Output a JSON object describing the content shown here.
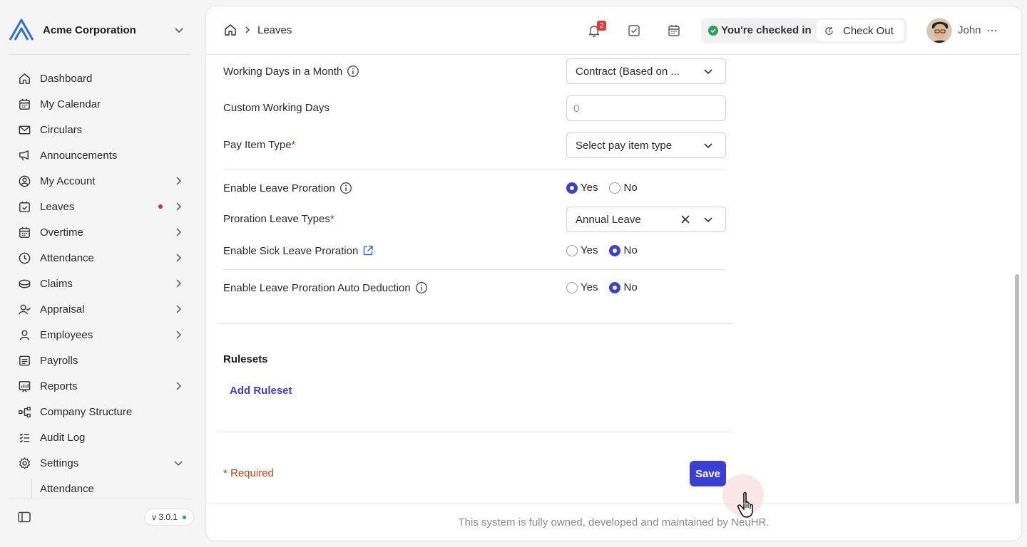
{
  "org": {
    "name": "Acme Corporation"
  },
  "sidebar": {
    "items": [
      {
        "label": "Dashboard",
        "icon": "home-icon"
      },
      {
        "label": "My Calendar",
        "icon": "calendar-icon"
      },
      {
        "label": "Circulars",
        "icon": "mail-icon"
      },
      {
        "label": "Announcements",
        "icon": "megaphone-icon"
      },
      {
        "label": "My Account",
        "icon": "user-circle-icon"
      },
      {
        "label": "Leaves",
        "icon": "calendar-check-icon"
      },
      {
        "label": "Overtime",
        "icon": "calendar-clock-icon"
      },
      {
        "label": "Attendance",
        "icon": "clock-icon"
      },
      {
        "label": "Claims",
        "icon": "coins-icon"
      },
      {
        "label": "Appraisal",
        "icon": "user-check-icon"
      },
      {
        "label": "Employees",
        "icon": "user-icon"
      },
      {
        "label": "Payrolls",
        "icon": "receipt-icon"
      },
      {
        "label": "Reports",
        "icon": "chart-icon"
      },
      {
        "label": "Company Structure",
        "icon": "structure-icon"
      },
      {
        "label": "Audit Log",
        "icon": "list-check-icon"
      },
      {
        "label": "Settings",
        "icon": "gear-icon"
      }
    ],
    "sub_item_partial": "Attendance",
    "version": "v 3.0.1"
  },
  "header": {
    "breadcrumb": "Leaves",
    "notification_count": "2",
    "checkin_status": "You're checked in",
    "checkout_label": "Check Out",
    "user_name": "John"
  },
  "form": {
    "working_days_label": "Working Days in a Month",
    "working_days_value": "Contract (Based on ...",
    "custom_days_label": "Custom Working Days",
    "custom_days_placeholder": "0",
    "pay_item_label": "Pay Item Type",
    "pay_item_placeholder": "Select pay item type",
    "required_mark": "*",
    "enable_proration_label": "Enable Leave Proration",
    "proration_types_label": "Proration Leave Types",
    "proration_types_value": "Annual Leave",
    "sick_proration_label": "Enable Sick Leave Proration",
    "auto_deduction_label": "Enable Leave Proration Auto Deduction",
    "yes_label": "Yes",
    "no_label": "No",
    "enable_proration_selected": "Yes",
    "sick_proration_selected": "No",
    "auto_deduction_selected": "No"
  },
  "rulesets": {
    "title": "Rulesets",
    "add_label": "Add Ruleset"
  },
  "actions": {
    "required_note": "* Required",
    "save_label": "Save"
  },
  "footer": {
    "text": "This system is fully owned, developed and maintained by NeuHR."
  },
  "colors": {
    "accent": "#3b3fd8",
    "status_green": "#22a35a",
    "required_red": "#d93025",
    "badge_red": "#e53935"
  }
}
